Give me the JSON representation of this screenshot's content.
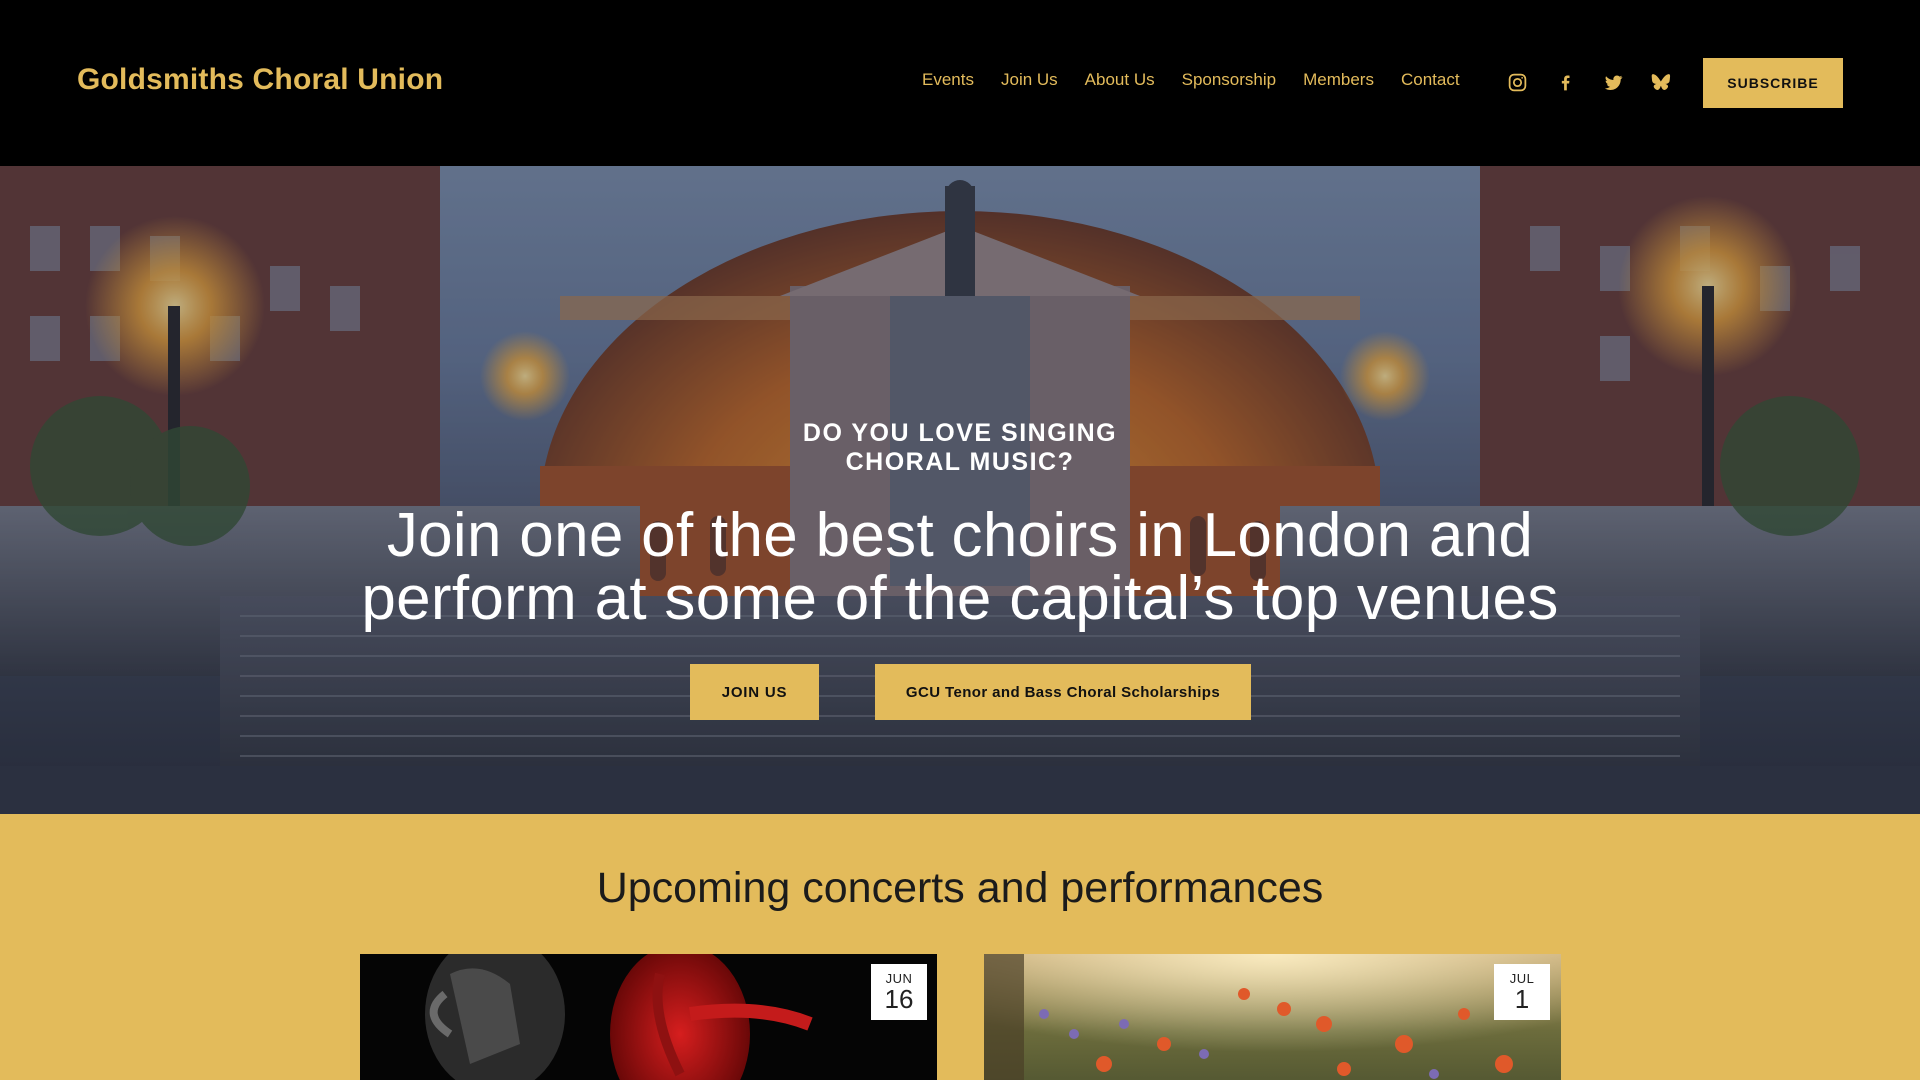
{
  "header": {
    "site_title": "Goldsmiths Choral Union",
    "nav": [
      "Events",
      "Join Us",
      "About Us",
      "Sponsorship",
      "Members",
      "Contact"
    ],
    "socials": [
      "instagram-icon",
      "facebook-icon",
      "twitter-icon",
      "bluesky-icon"
    ],
    "subscribe_label": "SUBSCRIBE"
  },
  "hero": {
    "eyebrow_line1": "DO YOU LOVE SINGING",
    "eyebrow_line2": "CHORAL MUSIC?",
    "headline_line1": "Join one of the best choirs in London and",
    "headline_line2": "perform at some of the capital’s top venues",
    "buttons": [
      "JOIN US",
      "GCU Tenor and Bass Choral Scholarships"
    ]
  },
  "upcoming": {
    "title": "Upcoming concerts and performances",
    "events": [
      {
        "month": "JUN",
        "day": "16"
      },
      {
        "month": "JUL",
        "day": "1"
      }
    ]
  },
  "colors": {
    "accent": "#e3bb5b",
    "background_dark": "#000000",
    "text_light": "#ffffff"
  }
}
